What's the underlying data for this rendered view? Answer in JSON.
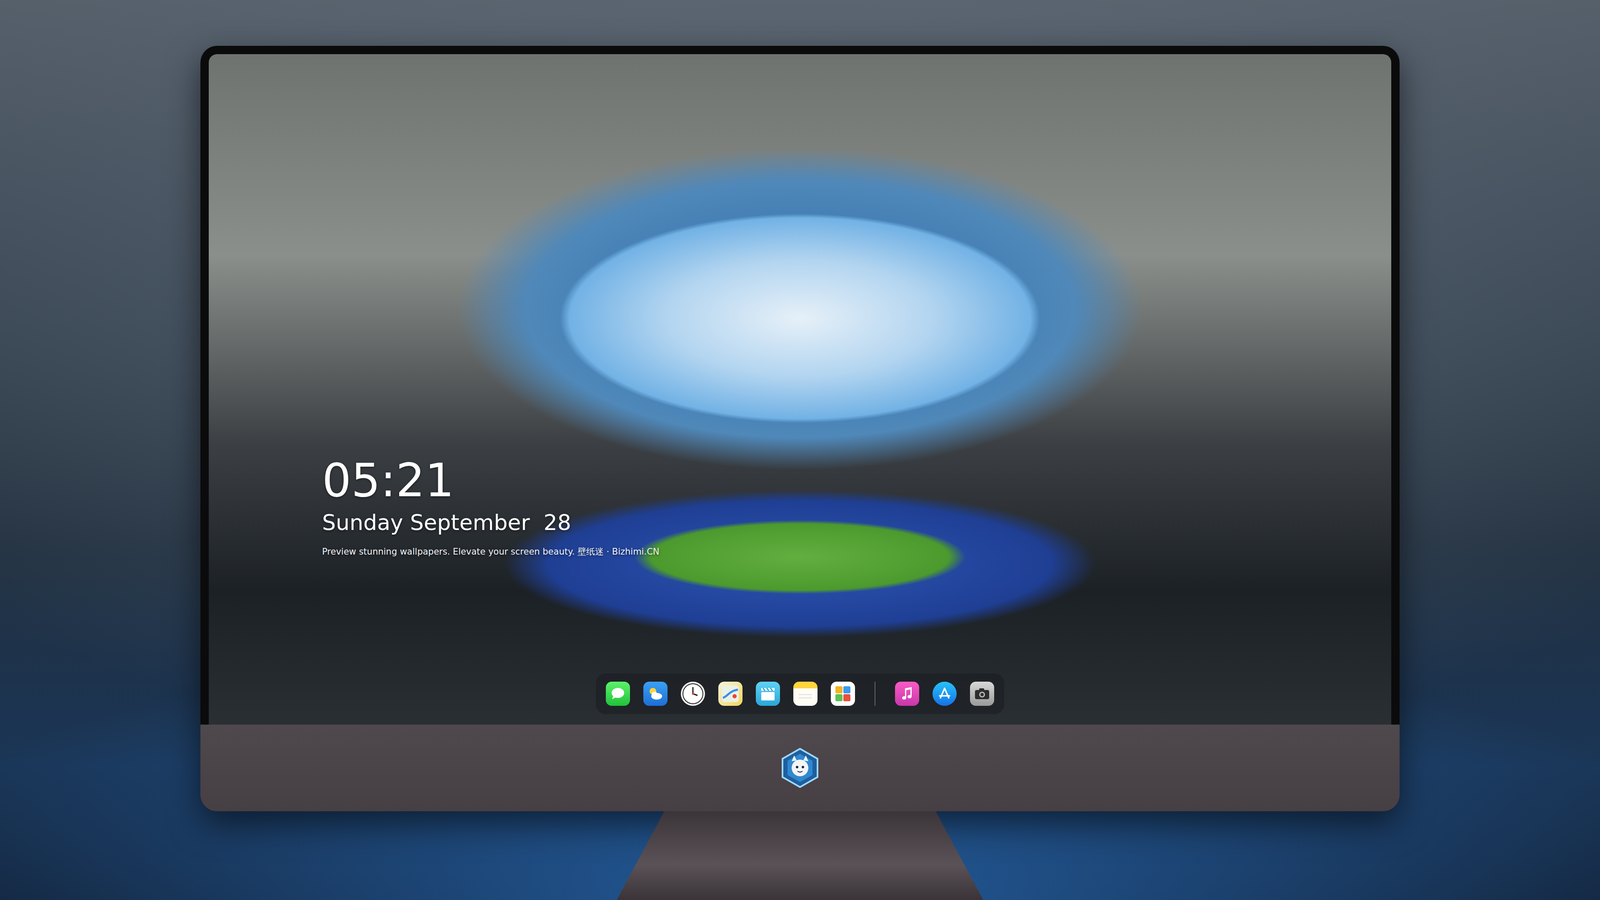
{
  "lock_screen": {
    "time": "05:21",
    "date": "Sunday September  28",
    "caption": "Preview stunning wallpapers. Elevate your screen beauty. 壁纸迷 · Bizhimi.CN"
  }
}
